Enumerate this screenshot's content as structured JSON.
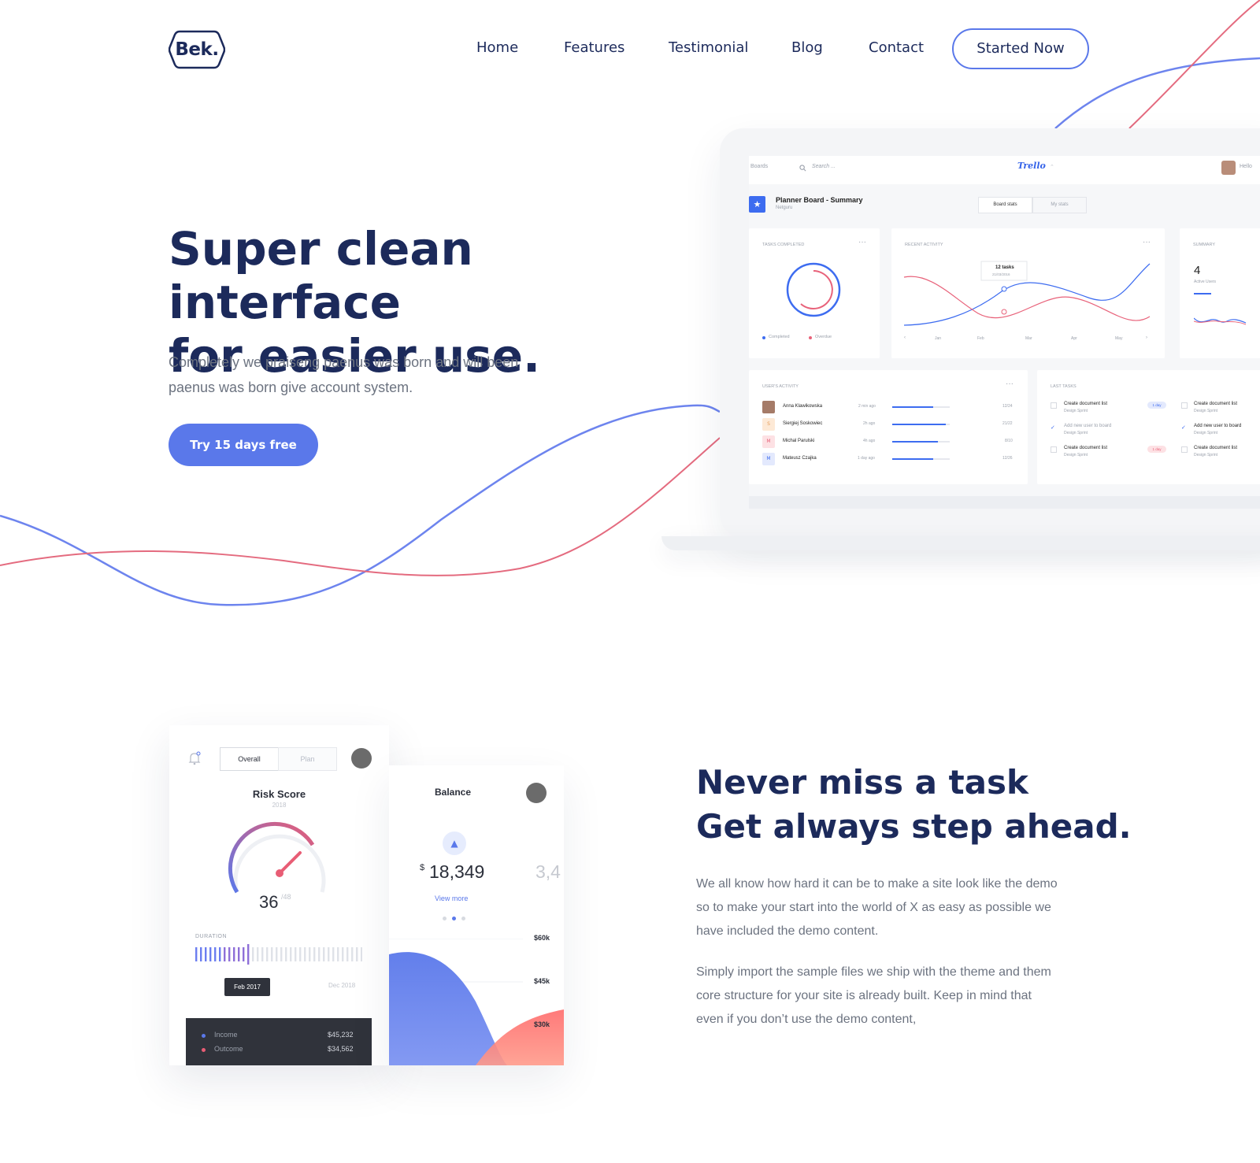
{
  "header": {
    "logo_text": "Bek.",
    "nav": [
      {
        "label": "Home"
      },
      {
        "label": "Features"
      },
      {
        "label": "Testimonial"
      },
      {
        "label": "Blog"
      },
      {
        "label": "Contact"
      }
    ],
    "cta_label": "Started Now"
  },
  "hero": {
    "title_line1": "Super clean interface",
    "title_line2": "for easier use.",
    "subtitle_line1": "Completely we praiseng paenus was born and will been",
    "subtitle_line2": "paenus was born give account system.",
    "cta_label": "Try 15 days free"
  },
  "dashboard": {
    "nav_boards": "Boards",
    "search_placeholder": "Search ...",
    "brand": "Trello",
    "hello": "Hello",
    "board_title": "Planner Board - Summary",
    "board_org": "Netguru",
    "tab_board_stats": "Board stats",
    "tab_my_stats": "My stats",
    "tasks_completed": "TASKS COMPLETED",
    "legend_completed": "Completed",
    "legend_overdue": "Overdue",
    "recent_activity": "RECENT ACTIVITY",
    "tooltip_value": "12 tasks",
    "tooltip_date": "21/03/2016",
    "months": [
      "Jan",
      "Feb",
      "Mar",
      "Apr",
      "May"
    ],
    "summary": "SUMMARY",
    "summary_value": "4",
    "summary_label": "Active Users",
    "users_activity": "USER'S ACTIVITY",
    "users": [
      {
        "initial": "",
        "name": "Anna Klawikowska",
        "time": "2 min ago",
        "ratio": "12/24"
      },
      {
        "initial": "S",
        "name": "Siergiej Soskowiec",
        "time": "2h ago",
        "ratio": "21/22"
      },
      {
        "initial": "M",
        "name": "Michal Parulski",
        "time": "4h ago",
        "ratio": "8/10"
      },
      {
        "initial": "M",
        "name": "Mateusz Czajka",
        "time": "1 day ago",
        "ratio": "12/26"
      }
    ],
    "last_tasks": "LAST TASKS",
    "tasks": [
      {
        "title": "Create document list",
        "sub": "Design Sprint",
        "badge": "1 day"
      },
      {
        "title": "Add new user to board",
        "sub": "Design Sprint",
        "badge": ""
      },
      {
        "title": "Create document list",
        "sub": "Design Sprint",
        "badge": "1 day"
      }
    ],
    "tasks_right": [
      {
        "title": "Create document list",
        "sub": "Design Sprint"
      },
      {
        "title": "Add new user to board",
        "sub": "Design Sprint"
      },
      {
        "title": "Create document list",
        "sub": "Design Sprint"
      }
    ]
  },
  "risk": {
    "tab_overall": "Overall",
    "tab_plan": "Plan",
    "title": "Risk Score",
    "year": "2018",
    "value": "36",
    "max": "/48",
    "duration_label": "DURATION",
    "tooltip": "Feb 2017",
    "end_label": "Dec 2018",
    "income_label": "Income",
    "income_value": "$45,232",
    "outcome_label": "Outcome",
    "outcome_value": "$34,562"
  },
  "balance": {
    "title": "Balance",
    "currency": "$",
    "amount": "18,349",
    "next_amount": "3,4",
    "view_more": "View more",
    "axis": [
      "$60k",
      "$45k",
      "$30k"
    ]
  },
  "section2": {
    "title_line1": "Never miss a task",
    "title_line2": "Get always step ahead.",
    "p1_line1": "We all know how hard it can be to make a site look like the demo",
    "p1_line2": "so to make your start into the world of X as easy as possible we",
    "p1_line3": "have included the demo content.",
    "p2_line1": "Simply import the sample files we ship with the theme and them",
    "p2_line2": "core structure for your site is already built. Keep in mind that",
    "p2_line3": "even if you don’t use the demo content,"
  },
  "colors": {
    "navy": "#1c2a5b",
    "accent_blue": "#5a78ea",
    "accent_red": "#e85d75",
    "text_gray": "#6c7380"
  }
}
